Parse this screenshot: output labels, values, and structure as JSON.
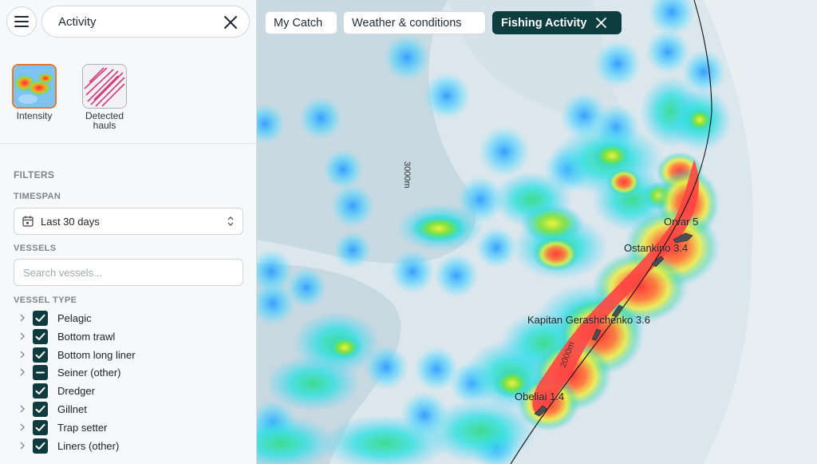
{
  "sidebar": {
    "search": {
      "value": "Activity"
    },
    "layers": [
      {
        "label": "Intensity"
      },
      {
        "label_line1": "Detected",
        "label_line2": "hauls"
      }
    ],
    "filters_title": "FILTERS",
    "timespan": {
      "title": "TIMESPAN",
      "value": "Last 30 days"
    },
    "vessels": {
      "title": "VESSELS",
      "placeholder": "Search vessels..."
    },
    "vessel_type": {
      "title": "VESSEL TYPE",
      "items": [
        {
          "label": "Pelagic",
          "state": "checked",
          "expandable": true
        },
        {
          "label": "Bottom trawl",
          "state": "checked",
          "expandable": true
        },
        {
          "label": "Bottom long liner",
          "state": "checked",
          "expandable": true
        },
        {
          "label": "Seiner (other)",
          "state": "indeterminate",
          "expandable": true
        },
        {
          "label": "Dredger",
          "state": "checked",
          "expandable": false
        },
        {
          "label": "Gillnet",
          "state": "checked",
          "expandable": true
        },
        {
          "label": "Trap setter",
          "state": "checked",
          "expandable": true
        },
        {
          "label": "Liners (other)",
          "state": "checked",
          "expandable": true
        }
      ]
    }
  },
  "map": {
    "chips": [
      {
        "label": "My Catch",
        "active": false
      },
      {
        "label": "Weather & conditions",
        "active": false
      },
      {
        "label": "Fishing Activity",
        "active": true
      }
    ],
    "contours": [
      {
        "label": "3000m"
      },
      {
        "label": "2000m"
      }
    ],
    "vessels": [
      {
        "label": "Orvar 5"
      },
      {
        "label": "Ostankino 3.4"
      },
      {
        "label": "Kapitan Gerashchenko 3.6"
      },
      {
        "label": "Obeliai 1.4"
      }
    ]
  }
}
